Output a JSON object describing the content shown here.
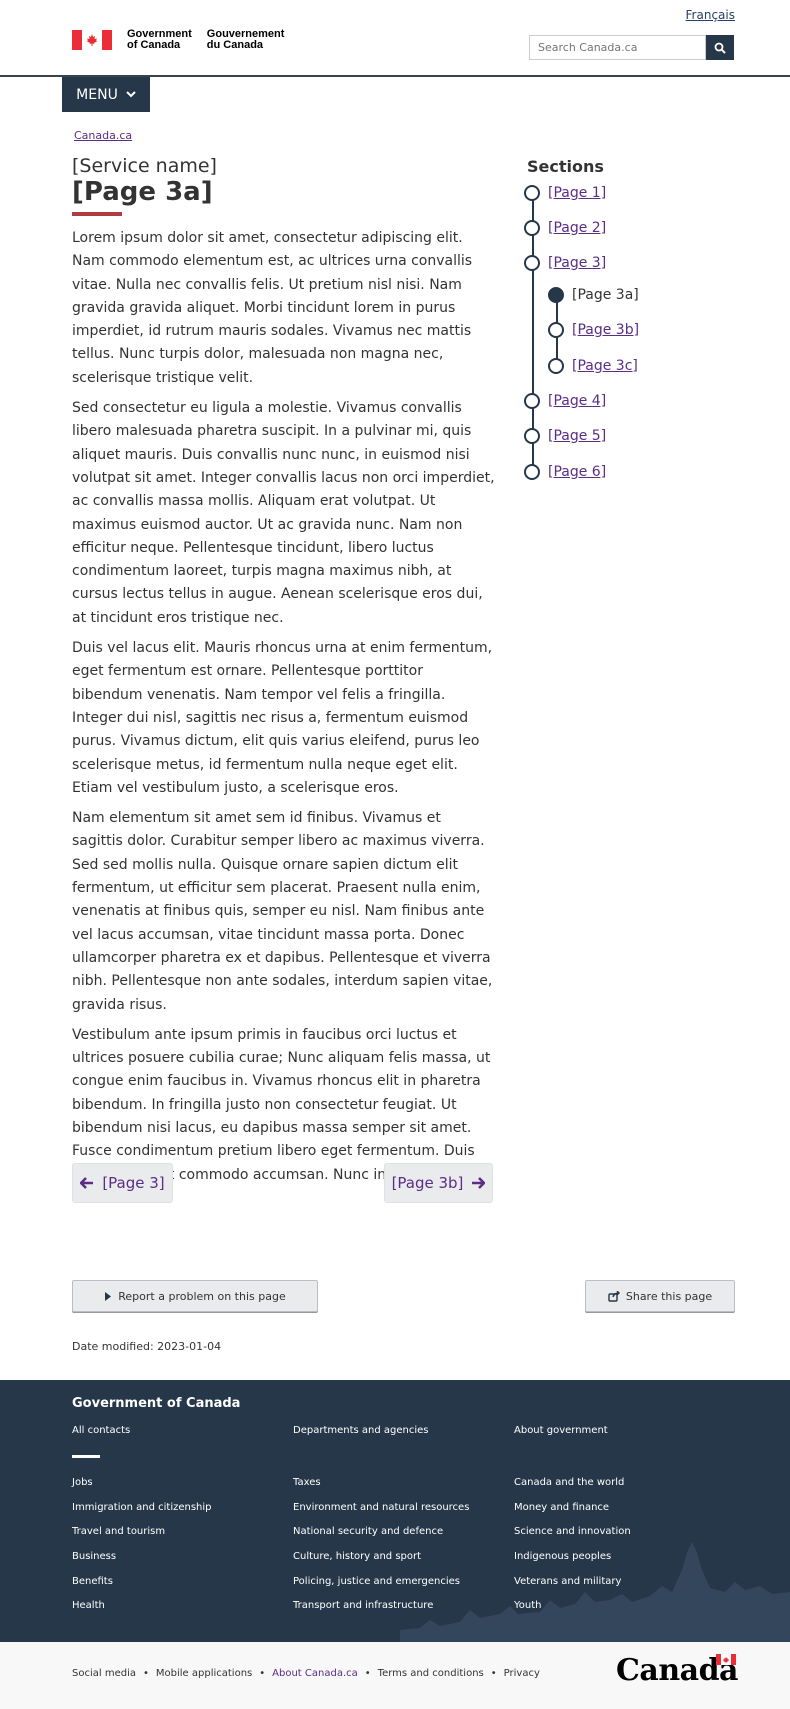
{
  "header": {
    "language_link": "Français",
    "wordmark_en": [
      "Government",
      "of Canada"
    ],
    "wordmark_fr": [
      "Gouvernement",
      "du Canada"
    ],
    "search_placeholder": "Search Canada.ca",
    "menu_label": "MENU"
  },
  "breadcrumb": "Canada.ca",
  "service_name": "[Service name]",
  "page_title": "[Page 3a]",
  "paragraphs": [
    "Lorem ipsum dolor sit amet, consectetur adipiscing elit. Nam commodo elementum est, ac ultrices urna convallis vitae. Nulla nec convallis felis. Ut pretium nisl nisi. Nam gravida gravida aliquet. Morbi tincidunt lorem in purus imperdiet, id rutrum mauris sodales. Vivamus nec mattis tellus. Nunc turpis dolor, malesuada non magna nec, scelerisque tristique velit.",
    "Sed consectetur eu ligula a molestie. Vivamus convallis libero malesuada pharetra suscipit. In a pulvinar mi, quis aliquet mauris. Duis convallis nunc nunc, in euismod nisi volutpat sit amet. Integer convallis lacus non orci imperdiet, ac convallis massa mollis. Aliquam erat volutpat. Ut maximus euismod auctor. Ut ac gravida nunc. Nam non efficitur neque. Pellentesque tincidunt, libero luctus condimentum laoreet, turpis magna maximus nibh, at cursus lectus tellus in augue. Aenean scelerisque eros dui, at tincidunt eros tristique nec.",
    "Duis vel lacus elit. Mauris rhoncus urna at enim fermentum, eget fermentum est ornare. Pellentesque porttitor bibendum venenatis. Nam tempor vel felis a fringilla. Integer dui nisl, sagittis nec risus a, fermentum euismod purus. Vivamus dictum, elit quis varius eleifend, purus leo scelerisque metus, id fermentum nulla neque eget elit. Etiam vel vestibulum justo, a scelerisque eros.",
    "Nam elementum sit amet sem id finibus. Vivamus et sagittis dolor. Curabitur semper libero ac maximus viverra. Sed sed mollis nulla. Quisque ornare sapien dictum elit fermentum, ut efficitur sem placerat. Praesent nulla enim, venenatis at finibus quis, semper eu nisl. Nam finibus ante vel lacus accumsan, vitae tincidunt massa porta. Donec ullamcorper pharetra ex et dapibus. Pellentesque et viverra nibh. Pellentesque non ante sodales, interdum sapien vitae, gravida risus.",
    "Vestibulum ante ipsum primis in faucibus orci luctus et ultrices posuere cubilia curae; Nunc aliquam felis massa, ut congue enim faucibus in. Vivamus rhoncus elit in pharetra bibendum. In fringilla justo non consectetur feugiat. Ut bibendum nisi lacus, eu dapibus massa semper sit amet. Fusce condimentum pretium libero eget fermentum. Duis feugiat velit at commodo accumsan. Nunc in felis leo."
  ],
  "sections": {
    "title": "Sections",
    "items": [
      {
        "label": "[Page 1]",
        "current": false,
        "sub": false
      },
      {
        "label": "[Page 2]",
        "current": false,
        "sub": false
      },
      {
        "label": "[Page 3]",
        "current": false,
        "sub": false
      },
      {
        "label": "[Page 3a]",
        "current": true,
        "sub": true
      },
      {
        "label": "[Page 3b]",
        "current": false,
        "sub": true
      },
      {
        "label": "[Page 3c]",
        "current": false,
        "sub": true
      },
      {
        "label": "[Page 4]",
        "current": false,
        "sub": false
      },
      {
        "label": "[Page 5]",
        "current": false,
        "sub": false
      },
      {
        "label": "[Page 6]",
        "current": false,
        "sub": false
      }
    ]
  },
  "pager": {
    "prev_label": "[Page 3]",
    "next_label": "[Page 3b]"
  },
  "utility": {
    "report_label": "Report a problem on this page",
    "share_label": "Share this page"
  },
  "date_modified": "Date modified: 2023-01-04",
  "footer": {
    "title": "Government of Canada",
    "top_links": [
      "All contacts",
      "Departments and agencies",
      "About government"
    ],
    "col1": [
      "Jobs",
      "Immigration and citizenship",
      "Travel and tourism",
      "Business",
      "Benefits",
      "Health"
    ],
    "col2": [
      "Taxes",
      "Environment and natural resources",
      "National security and defence",
      "Culture, history and sport",
      "Policing, justice and emergencies",
      "Transport and infrastructure"
    ],
    "col3": [
      "Canada and the world",
      "Money and finance",
      "Science and innovation",
      "Indigenous peoples",
      "Veterans and military",
      "Youth"
    ],
    "sub_links": [
      "Social media",
      "Mobile applications",
      "About Canada.ca",
      "Terms and conditions",
      "Privacy"
    ],
    "canada_wordmark": "Canada"
  },
  "colors": {
    "navy": "#26374a",
    "link_visited": "#5b2d86",
    "flag_red": "#eb2d37",
    "title_underline": "#af3c43"
  }
}
